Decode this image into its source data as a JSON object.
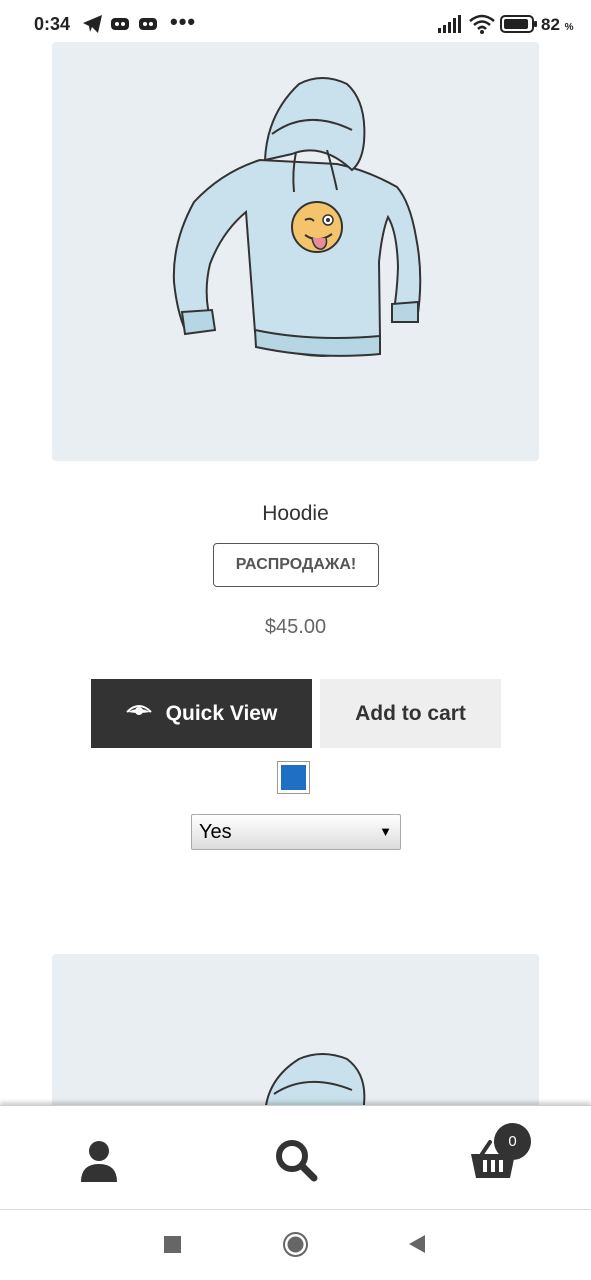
{
  "status_bar": {
    "time": "0:34",
    "icons": [
      "telegram-icon",
      "discord-icon",
      "discord-icon",
      "more-dots-icon",
      "signal-icon",
      "wifi-icon",
      "battery-icon"
    ],
    "dots": "•••",
    "battery_value": "82",
    "battery_unit": "%"
  },
  "product": {
    "title": "Hoodie",
    "sale_badge": "РАСПРОДАЖА!",
    "price": "$45.00",
    "quick_view_label": "Quick View",
    "add_to_cart_label": "Add to cart",
    "swatch_color": "#1f6fc5",
    "option_selected": "Yes"
  },
  "bottom_nav": {
    "items": [
      "account-icon",
      "search-icon",
      "cart-icon"
    ],
    "cart_count": "0"
  },
  "colors": {
    "dark": "#333333",
    "light_button": "#eeeeee",
    "image_bg": "#e9eef2",
    "hoodie_fill": "#c9e1ec"
  }
}
